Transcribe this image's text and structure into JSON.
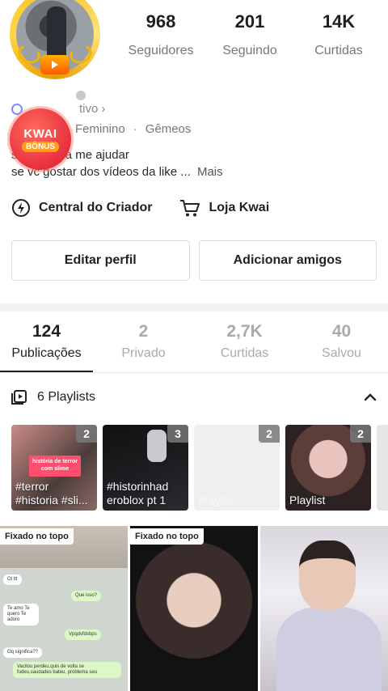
{
  "profile": {
    "stats": [
      {
        "value": "968",
        "label": "Seguidores"
      },
      {
        "value": "201",
        "label": "Seguindo"
      },
      {
        "value": "14K",
        "label": "Curtidas"
      }
    ],
    "active_label": "tivo",
    "age_fragment": "0",
    "gender": "Feminino",
    "sign": "Gêmeos",
    "bio_line1": "s         para me ajudar",
    "bio_line2": "se vc gostar dos vídeos da like ...",
    "more_label": "Mais"
  },
  "kwai_bonus": {
    "line1": "KWAI",
    "line2": "BÔNUS"
  },
  "shortcuts": {
    "creator": "Central do Criador",
    "store": "Loja Kwai"
  },
  "buttons": {
    "edit": "Editar perfil",
    "add_friends": "Adicionar amigos"
  },
  "tabs": [
    {
      "count": "124",
      "label": "Publicações"
    },
    {
      "count": "2",
      "label": "Privado"
    },
    {
      "count": "2,7K",
      "label": "Curtidas"
    },
    {
      "count": "40",
      "label": "Salvou"
    }
  ],
  "playlists": {
    "header": "6 Playlists",
    "items": [
      {
        "count": "2",
        "caption": "#terror #historia #sli...",
        "tag": "história de terror com slime"
      },
      {
        "count": "3",
        "caption": "#historinhad eroblox pt 1"
      },
      {
        "count": "2",
        "caption": "Playlist"
      },
      {
        "count": "2",
        "caption": "Playlist"
      }
    ]
  },
  "grid": {
    "pinned_label": "Fixado no topo",
    "chat": [
      "Oi ttt",
      "Que isso?",
      "Te amo Te quero Te adoro",
      "Vpqdvfdsbps",
      "Oq significa??",
      "Vacilou perdeu,quis de volta se fudeu,saudades bateu, problema seu"
    ]
  },
  "colors": {
    "accent": "#f7c21a",
    "kwai_red": "#e8303f",
    "text": "#1f1f1f",
    "muted": "#aaaaaa"
  }
}
